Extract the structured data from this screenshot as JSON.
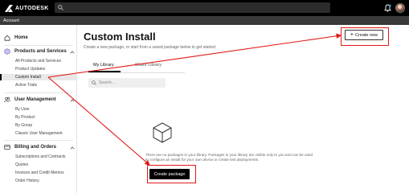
{
  "app": {
    "brand": "AUTODESK",
    "account_label": "Account"
  },
  "topbar": {
    "search_icon": "search-icon",
    "bell_icon": "bell-icon"
  },
  "sidebar": {
    "home": "Home",
    "products_and_services": {
      "label": "Products and Services",
      "items": [
        "All Products and Services",
        "Product Updates",
        "Custom Install",
        "Active Trials"
      ]
    },
    "user_management": {
      "label": "User Management",
      "items": [
        "By User",
        "By Product",
        "By Group",
        "Classic User Management"
      ]
    },
    "billing_and_orders": {
      "label": "Billing and Orders",
      "items": [
        "Subscriptions and Contracts",
        "Quotes",
        "Invoices and Credit Memos",
        "Order History"
      ]
    }
  },
  "main": {
    "title": "Custom Install",
    "subtitle": "Create a new package, or start from a saved package below to get started",
    "create_new_label": "Create new",
    "tabs": [
      "My Library",
      "Share Library"
    ],
    "search_placeholder": "Search...",
    "empty_message": "There are no packages in your library. Packages in your library are visible only to you and can be used to configure an install for your own device or create test deployments.",
    "create_package_label": "Create package"
  },
  "colors": {
    "highlight": "#e01818",
    "topbar": "#000000",
    "subbar": "#3a3a3a",
    "accent": "#000000"
  }
}
